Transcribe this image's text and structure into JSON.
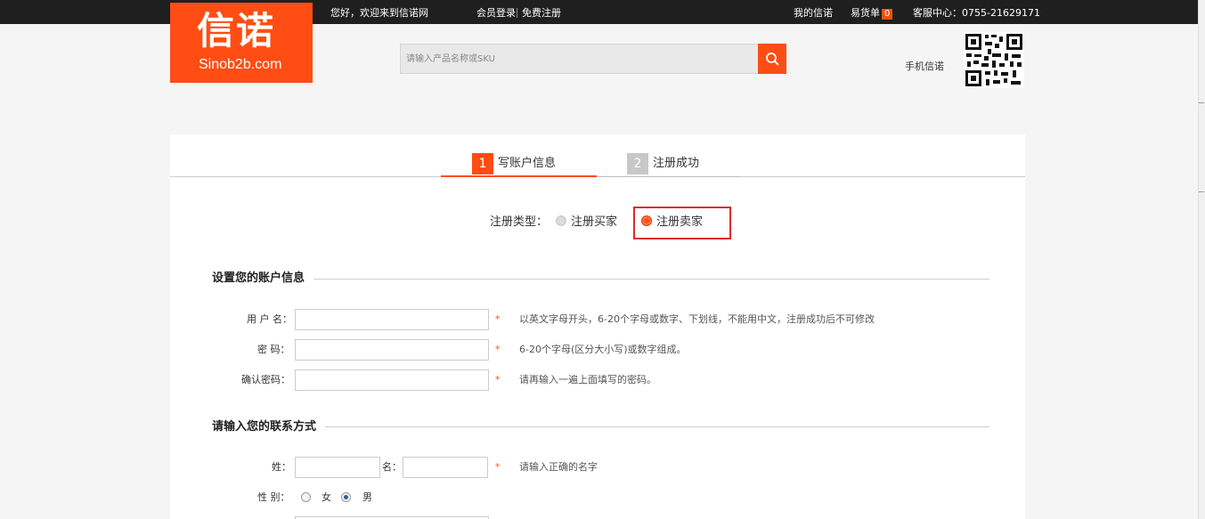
{
  "topbar": {
    "greeting": "您好，欢迎来到信诺网",
    "login": "会员登录",
    "register": "免费注册",
    "my_account": "我的信诺",
    "cart_label": "易货单",
    "cart_count": "0",
    "service": "客服中心：0755-21629171"
  },
  "header": {
    "logo_main": "信诺",
    "logo_sub": "Sinob2b.com",
    "search_placeholder": "请输入产品名称或SKU",
    "mobile_label": "手机信诺"
  },
  "steps": [
    {
      "num": "1",
      "label": "写账户信息"
    },
    {
      "num": "2",
      "label": "注册成功"
    }
  ],
  "register_type": {
    "label": "注册类型：",
    "options": [
      "注册买家",
      "注册卖家"
    ],
    "selected": "注册卖家"
  },
  "account_section": {
    "title": "设置您的账户信息",
    "fields": [
      {
        "label": "用 户 名：",
        "hint": "以英文字母开头，6-20个字母或数字、下划线，不能用中文，注册成功后不可修改"
      },
      {
        "label": "密  码：",
        "hint": "6-20个字母(区分大小写)或数字组成。"
      },
      {
        "label": "确认密码：",
        "hint": "请再输入一遍上面填写的密码。"
      }
    ],
    "required_mark": "*"
  },
  "contact_section": {
    "title": "请输入您的联系方式",
    "surname_label": "姓：",
    "name_label": "名：",
    "name_hint": "请输入正确的名字",
    "gender_label": "性 别：",
    "gender_options": [
      "女",
      "男"
    ],
    "gender_selected": "男"
  },
  "colors": {
    "brand": "#ff4d14",
    "topbar_bg": "#1f1f1f",
    "highlight_box": "#e02b2b"
  }
}
